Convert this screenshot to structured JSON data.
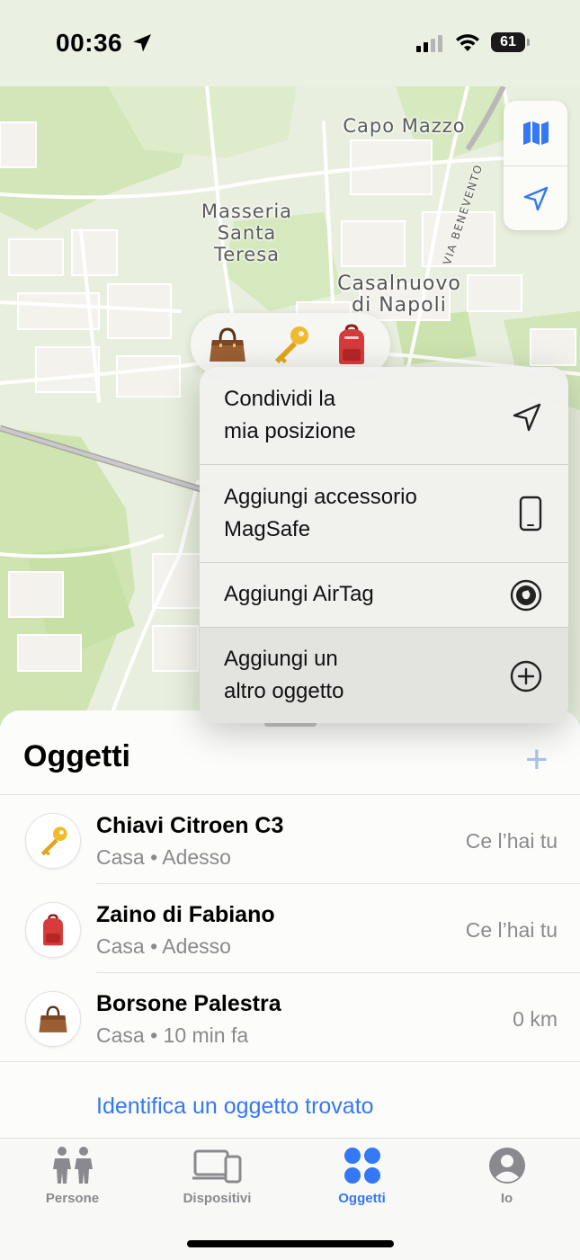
{
  "status_bar": {
    "time": "00:36",
    "battery": "61"
  },
  "map": {
    "labels": [
      "Capo Mazzo",
      "Masseria\nSanta\nTeresa",
      "Casalnuovo\ndi Napoli"
    ],
    "road_label": "VIA BENEVENTO",
    "controls": {
      "map_icon": "map-icon",
      "locate_icon": "location-arrow-icon"
    }
  },
  "emoji_pill": {
    "items": [
      "handbag-icon",
      "key-icon",
      "backpack-icon"
    ]
  },
  "menu": {
    "items": [
      {
        "label": "Condividi la\nmia posizione",
        "icon": "location-arrow-icon"
      },
      {
        "label": "Aggiungi accessorio\nMagSafe",
        "icon": "iphone-icon"
      },
      {
        "label": "Aggiungi AirTag",
        "icon": "airtag-icon"
      },
      {
        "label": "Aggiungi un\naltro oggetto",
        "icon": "plus-circle-icon"
      }
    ]
  },
  "sheet": {
    "title": "Oggetti",
    "add_label": "+",
    "items": [
      {
        "name": "Chiavi Citroen C3",
        "subtitle": "Casa • Adesso",
        "status": "Ce l’hai tu",
        "icon": "key-icon"
      },
      {
        "name": "Zaino di Fabiano",
        "subtitle": "Casa • Adesso",
        "status": "Ce l’hai tu",
        "icon": "backpack-icon"
      },
      {
        "name": "Borsone Palestra",
        "subtitle": "Casa • 10 min fa",
        "status": "0 km",
        "icon": "handbag-icon"
      }
    ],
    "identify_link": "Identifica un oggetto trovato"
  },
  "tab_bar": {
    "tabs": [
      {
        "label": "Persone",
        "icon": "people-icon",
        "active": false
      },
      {
        "label": "Dispositivi",
        "icon": "devices-icon",
        "active": false
      },
      {
        "label": "Oggetti",
        "icon": "items-icon",
        "active": true
      },
      {
        "label": "Io",
        "icon": "person-icon",
        "active": false
      }
    ]
  },
  "colors": {
    "accent": "#3478f6",
    "secondary_text": "#8a8a8e",
    "map_green": "#c9e2a8"
  }
}
